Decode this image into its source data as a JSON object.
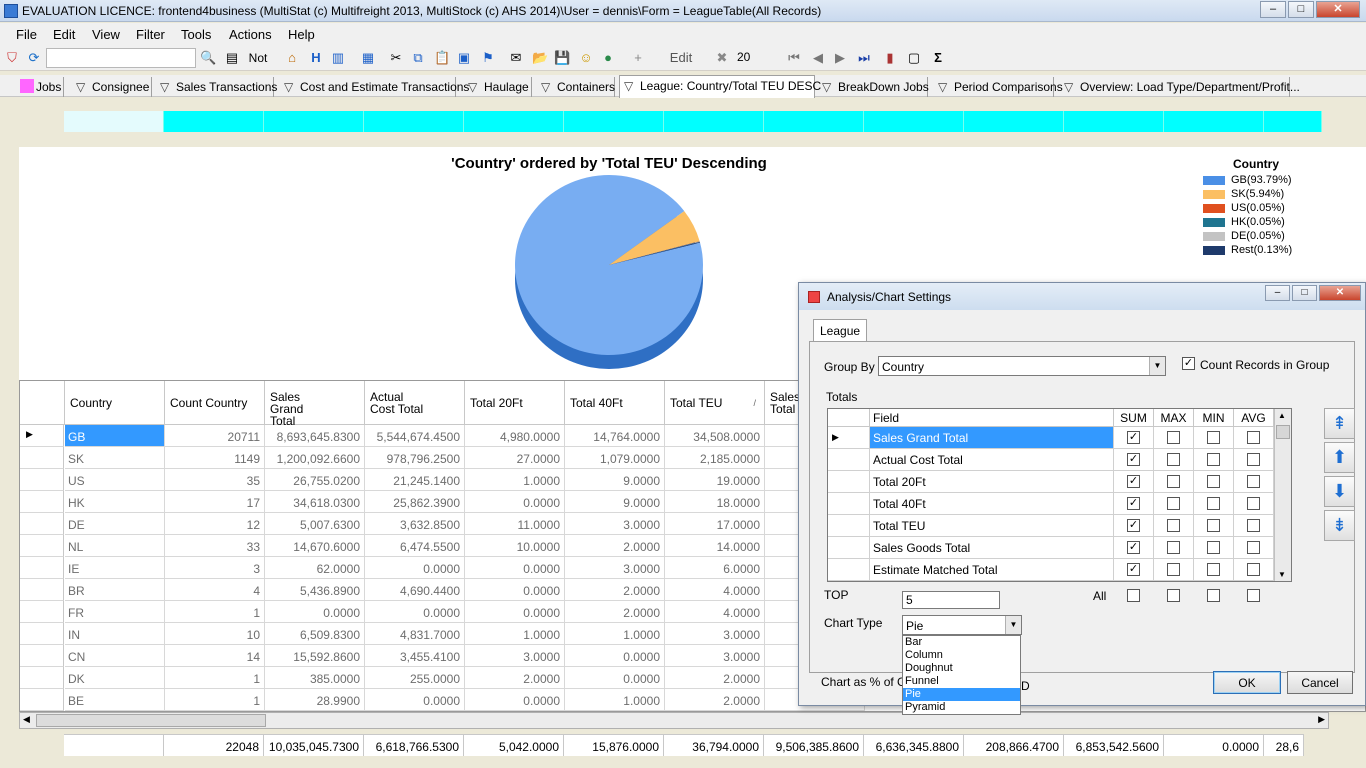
{
  "window": {
    "title": "EVALUATION LICENCE: frontend4business (MultiStat (c) Multifreight 2013, MultiStock (c) AHS 2014)\\User = dennis\\Form = LeagueTable(All Records)",
    "minimize": "–",
    "maximize": "□",
    "close": "✕"
  },
  "menu": [
    "File",
    "Edit",
    "View",
    "Filter",
    "Tools",
    "Actions",
    "Help"
  ],
  "toolbar": {
    "not_label": "Not",
    "h_label": "H",
    "edit_label": "Edit",
    "count_value": "20",
    "plus": "+",
    "sigma": "Σ"
  },
  "tabs": [
    "Jobs",
    "Consignee",
    "Sales Transactions",
    "Cost and Estimate Transactions",
    "Haulage",
    "Containers",
    "League: Country/Total TEU DESC",
    "BreakDown Jobs",
    "Period Comparisons",
    "Overview: Load Type/Department/Profit..."
  ],
  "chart_data": {
    "type": "pie",
    "title": "'Country' ordered by 'Total TEU' Descending",
    "legend_title": "Country",
    "legend_position": "top-right",
    "slices": [
      {
        "label": "GB(93.79%)",
        "value": 93.79,
        "color": "#4a8fe6"
      },
      {
        "label": "SK(5.94%)",
        "value": 5.94,
        "color": "#fbbf63"
      },
      {
        "label": "US(0.05%)",
        "value": 0.05,
        "color": "#e0501f"
      },
      {
        "label": "HK(0.05%)",
        "value": 0.05,
        "color": "#1f7590"
      },
      {
        "label": "DE(0.05%)",
        "value": 0.05,
        "color": "#c3c3c3"
      },
      {
        "label": "Rest(0.13%)",
        "value": 0.13,
        "color": "#1e3a6b"
      }
    ]
  },
  "grid": {
    "headers": [
      "Country",
      "Count Country",
      "Sales Grand Total",
      "Actual Cost Total",
      "Total 20Ft",
      "Total 40Ft",
      "Total TEU",
      "Sales Total"
    ],
    "sort_glyph": "/",
    "rows": [
      [
        "GB",
        "20711",
        "8,693,645.8300",
        "5,544,674.4500",
        "4,980.0000",
        "14,764.0000",
        "34,508.0000",
        "8,"
      ],
      [
        "SK",
        "1149",
        "1,200,092.6600",
        "978,796.2500",
        "27.0000",
        "1,079.0000",
        "2,185.0000",
        "1,"
      ],
      [
        "US",
        "35",
        "26,755.0200",
        "21,245.1400",
        "1.0000",
        "9.0000",
        "19.0000",
        ""
      ],
      [
        "HK",
        "17",
        "34,618.0300",
        "25,862.3900",
        "0.0000",
        "9.0000",
        "18.0000",
        ""
      ],
      [
        "DE",
        "12",
        "5,007.6300",
        "3,632.8500",
        "11.0000",
        "3.0000",
        "17.0000",
        ""
      ],
      [
        "NL",
        "33",
        "14,670.6000",
        "6,474.5500",
        "10.0000",
        "2.0000",
        "14.0000",
        ""
      ],
      [
        "IE",
        "3",
        "62.0000",
        "0.0000",
        "0.0000",
        "3.0000",
        "6.0000",
        ""
      ],
      [
        "BR",
        "4",
        "5,436.8900",
        "4,690.4400",
        "0.0000",
        "2.0000",
        "4.0000",
        ""
      ],
      [
        "FR",
        "1",
        "0.0000",
        "0.0000",
        "0.0000",
        "2.0000",
        "4.0000",
        ""
      ],
      [
        "IN",
        "10",
        "6,509.8300",
        "4,831.7000",
        "1.0000",
        "1.0000",
        "3.0000",
        ""
      ],
      [
        "CN",
        "14",
        "15,592.8600",
        "3,455.4100",
        "3.0000",
        "0.0000",
        "3.0000",
        ""
      ],
      [
        "DK",
        "1",
        "385.0000",
        "255.0000",
        "2.0000",
        "0.0000",
        "2.0000",
        ""
      ],
      [
        "BE",
        "1",
        "28.9900",
        "0.0000",
        "0.0000",
        "1.0000",
        "2.0000",
        ""
      ]
    ],
    "totals": [
      "",
      "22048",
      "10,035,045.7300",
      "6,618,766.5300",
      "5,042.0000",
      "15,876.0000",
      "36,794.0000",
      "9,506,385.8600",
      "6,636,345.8800",
      "208,866.4700",
      "6,853,542.5600",
      "0.0000",
      "28,6"
    ]
  },
  "dialog": {
    "title": "Analysis/Chart Settings",
    "tab": "League",
    "group_by_label": "Group By",
    "group_by_value": "Country",
    "count_records_label": "Count Records in Group",
    "totals_label": "Totals",
    "columns": [
      "Field",
      "SUM",
      "MAX",
      "MIN",
      "AVG"
    ],
    "fields": [
      {
        "name": "Sales Grand Total",
        "sum": true
      },
      {
        "name": "Actual Cost Total",
        "sum": true
      },
      {
        "name": "Total 20Ft",
        "sum": true
      },
      {
        "name": "Total 40Ft",
        "sum": true
      },
      {
        "name": "Total TEU",
        "sum": true
      },
      {
        "name": "Sales Goods Total",
        "sum": true
      },
      {
        "name": "Estimate Matched Total",
        "sum": true
      }
    ],
    "top_label": "TOP",
    "top_value": "5",
    "all_label": "All",
    "chart_type_label": "Chart Type",
    "chart_type_value": "Pie",
    "chart_options": [
      "Bar",
      "Column",
      "Doughnut",
      "Funnel",
      "Pie",
      "Pyramid"
    ],
    "chart_pct_label": "Chart as % of G",
    "chart_pct_tail": "D",
    "ok": "OK",
    "cancel": "Cancel"
  }
}
